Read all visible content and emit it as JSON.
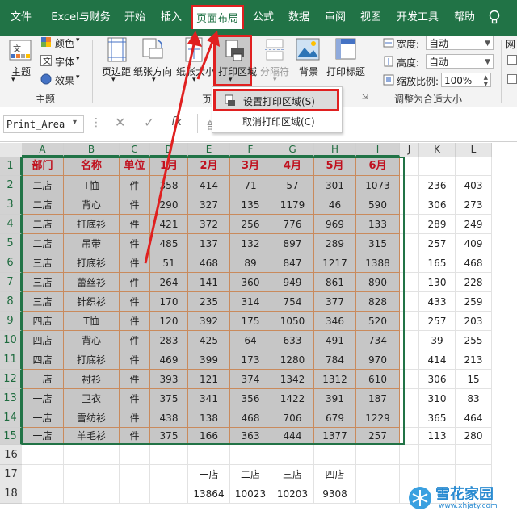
{
  "menu": {
    "items": [
      "文件",
      "Excel与财务",
      "开始",
      "插入",
      "页面布局",
      "公式",
      "数据",
      "审阅",
      "视图",
      "开发工具",
      "帮助"
    ],
    "active": "页面布局",
    "extra_icon": "lightbulb-icon"
  },
  "ribbon": {
    "themes": {
      "label": "主题",
      "colors": "颜色",
      "fonts": "字体",
      "effects": "效果",
      "group": "主题"
    },
    "page_setup": {
      "margins": "页边距",
      "orientation": "纸张方向",
      "size": "纸张大小",
      "print_area": "打印区域",
      "breaks": "分隔符",
      "background": "背景",
      "print_titles": "打印标题",
      "group": "页"
    },
    "scale": {
      "width_label": "宽度:",
      "width_value": "自动",
      "height_label": "高度:",
      "height_value": "自动",
      "scale_label": "缩放比例:",
      "scale_value": "100%",
      "group": "调整为合适大小"
    },
    "sheet_options_partial": "网"
  },
  "dropdown": {
    "set_print_area": "设置打印区域(S)",
    "clear_print_area": "取消打印区域(C)"
  },
  "formula_bar": {
    "name_box": "Print_Area",
    "fx": "fx",
    "content": "部"
  },
  "columns": [
    "A",
    "B",
    "C",
    "D",
    "E",
    "F",
    "G",
    "H",
    "I",
    "J",
    "K",
    "L"
  ],
  "rows": [
    "1",
    "2",
    "3",
    "4",
    "5",
    "6",
    "7",
    "8",
    "9",
    "10",
    "11",
    "12",
    "13",
    "14",
    "15",
    "16",
    "17",
    "18"
  ],
  "table": {
    "headers": [
      "部门",
      "名称",
      "单位",
      "1月",
      "2月",
      "3月",
      "4月",
      "5月",
      "6月"
    ],
    "rows": [
      [
        "二店",
        "T恤",
        "件",
        "358",
        "414",
        "71",
        "57",
        "301",
        "1073"
      ],
      [
        "二店",
        "背心",
        "件",
        "290",
        "327",
        "135",
        "1179",
        "46",
        "590"
      ],
      [
        "二店",
        "打底衫",
        "件",
        "421",
        "372",
        "256",
        "776",
        "969",
        "133"
      ],
      [
        "二店",
        "吊带",
        "件",
        "485",
        "137",
        "132",
        "897",
        "289",
        "315"
      ],
      [
        "三店",
        "打底衫",
        "件",
        "51",
        "468",
        "89",
        "847",
        "1217",
        "1388"
      ],
      [
        "三店",
        "蕾丝衫",
        "件",
        "264",
        "141",
        "360",
        "949",
        "861",
        "890"
      ],
      [
        "三店",
        "针织衫",
        "件",
        "170",
        "235",
        "314",
        "754",
        "377",
        "828"
      ],
      [
        "四店",
        "T恤",
        "件",
        "120",
        "392",
        "175",
        "1050",
        "346",
        "520"
      ],
      [
        "四店",
        "背心",
        "件",
        "283",
        "425",
        "64",
        "633",
        "491",
        "734"
      ],
      [
        "四店",
        "打底衫",
        "件",
        "469",
        "399",
        "173",
        "1280",
        "784",
        "970"
      ],
      [
        "一店",
        "衬衫",
        "件",
        "393",
        "121",
        "374",
        "1342",
        "1312",
        "610"
      ],
      [
        "一店",
        "卫衣",
        "件",
        "375",
        "341",
        "356",
        "1422",
        "391",
        "187"
      ],
      [
        "一店",
        "雪纺衫",
        "件",
        "438",
        "138",
        "468",
        "706",
        "679",
        "1229"
      ],
      [
        "一店",
        "羊毛衫",
        "件",
        "375",
        "166",
        "363",
        "444",
        "1377",
        "257"
      ]
    ]
  },
  "side_values": [
    [
      "236",
      "403"
    ],
    [
      "306",
      "273"
    ],
    [
      "289",
      "249"
    ],
    [
      "257",
      "409"
    ],
    [
      "165",
      "468"
    ],
    [
      "130",
      "228"
    ],
    [
      "433",
      "259"
    ],
    [
      "257",
      "203"
    ],
    [
      "39",
      "255"
    ],
    [
      "414",
      "213"
    ],
    [
      "306",
      "15"
    ],
    [
      "310",
      "83"
    ],
    [
      "365",
      "464"
    ],
    [
      "113",
      "280"
    ]
  ],
  "summary": {
    "labels": [
      "一店",
      "二店",
      "三店",
      "四店"
    ],
    "values": [
      "13864",
      "10023",
      "10203",
      "9308"
    ]
  },
  "watermark": {
    "title": "雪花家园",
    "url": "www.xhjaty.com"
  },
  "colors": {
    "accent": "#217346",
    "highlight_red": "#e02020",
    "header_text": "#c0101e",
    "table_fill": "#c6c6c6"
  }
}
